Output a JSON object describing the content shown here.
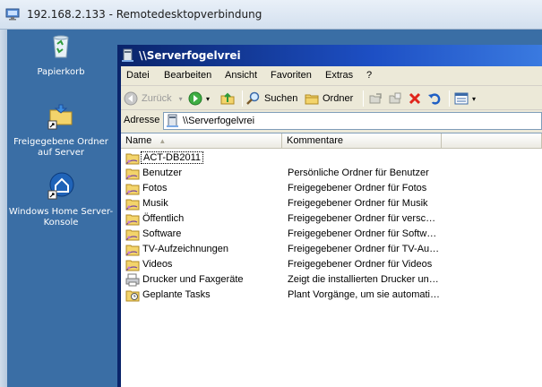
{
  "rdp": {
    "title": "192.168.2.133 - Remotedesktopverbindung"
  },
  "desktop": {
    "icons": [
      {
        "label": "Papierkorb",
        "icon": "recycle-bin-icon"
      },
      {
        "label": "Freigegebene Ordner auf Server",
        "icon": "shared-folders-shortcut-icon"
      },
      {
        "label": "Windows Home Server-Konsole",
        "icon": "home-server-console-shortcut-icon"
      }
    ]
  },
  "explorer": {
    "title": "\\\\Serverfogelvrei",
    "menu": [
      "Datei",
      "Bearbeiten",
      "Ansicht",
      "Favoriten",
      "Extras",
      "?"
    ],
    "toolbar": {
      "back": "Zurück",
      "search": "Suchen",
      "folders": "Ordner"
    },
    "address": {
      "label": "Adresse",
      "value": "\\\\Serverfogelvrei"
    },
    "columns": [
      "Name",
      "Kommentare"
    ],
    "rows": [
      {
        "name": "ACT-DB2011",
        "comment": "",
        "icon": "shared-folder-icon"
      },
      {
        "name": "Benutzer",
        "comment": "Persönliche Ordner für Benutzer",
        "icon": "shared-folder-icon"
      },
      {
        "name": "Fotos",
        "comment": "Freigegebener Ordner für Fotos",
        "icon": "shared-folder-icon"
      },
      {
        "name": "Musik",
        "comment": "Freigegebener Ordner für Musik",
        "icon": "shared-folder-icon"
      },
      {
        "name": "Öffentlich",
        "comment": "Freigegebener Ordner für versc…",
        "icon": "shared-folder-icon"
      },
      {
        "name": "Software",
        "comment": "Freigegebener Ordner für Softw…",
        "icon": "shared-folder-icon"
      },
      {
        "name": "TV-Aufzeichnungen",
        "comment": "Freigegebener Ordner für TV-Au…",
        "icon": "shared-folder-icon"
      },
      {
        "name": "Videos",
        "comment": "Freigegebener Ordner für Videos",
        "icon": "shared-folder-icon"
      },
      {
        "name": "Drucker und Faxgeräte",
        "comment": "Zeigt die installierten Drucker un…",
        "icon": "printer-icon"
      },
      {
        "name": "Geplante Tasks",
        "comment": "Plant Vorgänge, um sie automati…",
        "icon": "scheduled-tasks-icon"
      }
    ]
  },
  "colors": {
    "desktop_bg": "#3a6ea5",
    "title_active": "#0a246a",
    "window_face": "#ece9d8"
  }
}
